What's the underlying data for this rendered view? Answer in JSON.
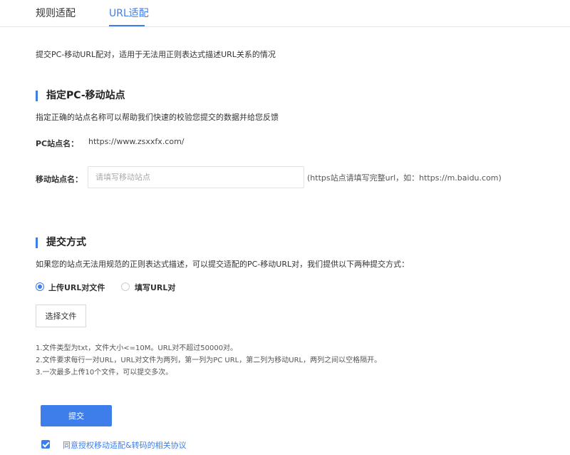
{
  "tabs": [
    {
      "label": "规则适配"
    },
    {
      "label": "URL适配"
    }
  ],
  "intro": "提交PC-移动URL配对，适用于无法用正则表达式描述URL关系的情况",
  "site_section": {
    "title": "指定PC-移动站点",
    "desc": "指定正确的站点名称可以帮助我们快速的校验您提交的数据并给您反馈",
    "pc_label": "PC站点名：",
    "pc_value": "https://www.zsxxfx.com/",
    "mobile_label": "移动站点名：",
    "mobile_placeholder": "请填写移动站点",
    "mobile_value": "",
    "mobile_hint": "(https站点请填写完整url，如：https://m.baidu.com)"
  },
  "submit_section": {
    "title": "提交方式",
    "desc": "如果您的站点无法用规范的正则表达式描述，可以提交适配的PC-移动URL对，我们提供以下两种提交方式：",
    "options": [
      {
        "label": "上传URL对文件",
        "selected": true
      },
      {
        "label": "填写URL对",
        "selected": false
      }
    ],
    "file_button": "选择文件",
    "notes": [
      "1.文件类型为txt，文件大小<=10M。URL对不超过50000对。",
      "2.文件要求每行一对URL，URL对文件为两列，第一列为PC URL，第二列为移动URL，两列之间以空格隔开。",
      "3.一次最多上传10个文件，可以提交多次。"
    ]
  },
  "actions": {
    "submit_label": "提交",
    "agreement_label": "同意授权移动适配&转码的相关协议",
    "agreement_checked": true
  },
  "colors": {
    "accent": "#3d7eea"
  }
}
